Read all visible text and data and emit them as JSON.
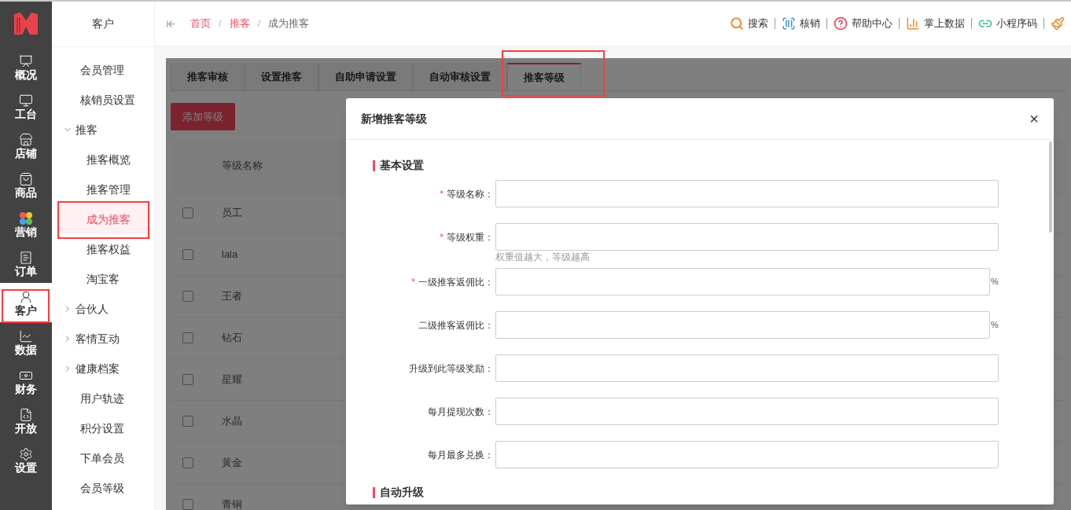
{
  "nav": [
    {
      "label": "概况",
      "kind": "overview",
      "selected": false
    },
    {
      "label": "工台",
      "kind": "desk",
      "selected": false
    },
    {
      "label": "店铺",
      "kind": "store",
      "selected": false
    },
    {
      "label": "商品",
      "kind": "goods",
      "selected": false
    },
    {
      "label": "营销",
      "kind": "marketing",
      "selected": false
    },
    {
      "label": "订单",
      "kind": "order",
      "selected": false
    },
    {
      "label": "客户",
      "kind": "customer",
      "selected": true
    },
    {
      "label": "数据",
      "kind": "data",
      "selected": false
    },
    {
      "label": "财务",
      "kind": "finance",
      "selected": false
    },
    {
      "label": "开放",
      "kind": "open",
      "selected": false
    },
    {
      "label": "设置",
      "kind": "settings",
      "selected": false
    }
  ],
  "submenu": {
    "title": "客户",
    "items": [
      {
        "label": "会员管理",
        "selected": false
      },
      {
        "label": "核销员设置",
        "selected": false
      },
      {
        "label": "推客",
        "expanded": true,
        "children": [
          {
            "label": "推客概览",
            "selected": false
          },
          {
            "label": "推客管理",
            "selected": false
          },
          {
            "label": "成为推客",
            "selected": true
          },
          {
            "label": "推客权益",
            "selected": false
          },
          {
            "label": "淘宝客",
            "selected": false
          }
        ]
      },
      {
        "label": "合伙人",
        "expanded": false
      },
      {
        "label": "客情互动",
        "expanded": false
      },
      {
        "label": "健康档案",
        "expanded": false
      },
      {
        "label": "用户轨迹",
        "selected": false
      },
      {
        "label": "积分设置",
        "selected": false
      },
      {
        "label": "下单会员",
        "selected": false
      },
      {
        "label": "会员等级",
        "selected": false
      }
    ]
  },
  "breadcrumb": [
    {
      "kind": "link",
      "label": "首页"
    },
    {
      "kind": "separator",
      "label": "/"
    },
    {
      "kind": "link",
      "label": "推客"
    },
    {
      "kind": "separator",
      "label": "/"
    },
    {
      "kind": "current",
      "label": "成为推客"
    }
  ],
  "toolbar": [
    {
      "label": "搜索",
      "kind": "search"
    },
    {
      "label": "核销",
      "kind": "scan"
    },
    {
      "label": "帮助中心",
      "kind": "help"
    },
    {
      "label": "掌上数据",
      "kind": "chart"
    },
    {
      "label": "小程序码",
      "kind": "miniapp"
    }
  ],
  "tabs": [
    {
      "label": "推客审核",
      "selected": false
    },
    {
      "label": "设置推客",
      "selected": false
    },
    {
      "label": "自助申请设置",
      "selected": false
    },
    {
      "label": "自动审核设置",
      "selected": false
    },
    {
      "label": "推客等级",
      "selected": true
    }
  ],
  "add_button": "添加等级",
  "table": {
    "columns": [
      "等级名称"
    ],
    "rows": [
      {
        "name": "员工",
        "checked": false
      },
      {
        "name": "lala",
        "checked": false
      },
      {
        "name": "王者",
        "checked": false
      },
      {
        "name": "钻石",
        "checked": false
      },
      {
        "name": "星耀",
        "checked": false
      },
      {
        "name": "水晶",
        "checked": false
      },
      {
        "name": "黃金",
        "checked": false
      },
      {
        "name": "青铜",
        "checked": false
      }
    ]
  },
  "modal": {
    "title": "新增推客等级",
    "close": "×",
    "sections": [
      {
        "title": "基本设置",
        "fields": [
          {
            "label": "等级名称：",
            "required_mark": "*"
          },
          {
            "label": "等级权重：",
            "required_mark": "*",
            "hint": "权重值越大，等级越高"
          },
          {
            "label": "一级推客返佣比：",
            "required_mark": "*",
            "suffix": "%"
          },
          {
            "label": "二级推客返佣比：",
            "suffix": "%"
          },
          {
            "label": "升级到此等级奖励："
          },
          {
            "label": "每月提现次数："
          },
          {
            "label": "每月最多兑换："
          }
        ]
      },
      {
        "title": "自动升级"
      }
    ]
  }
}
